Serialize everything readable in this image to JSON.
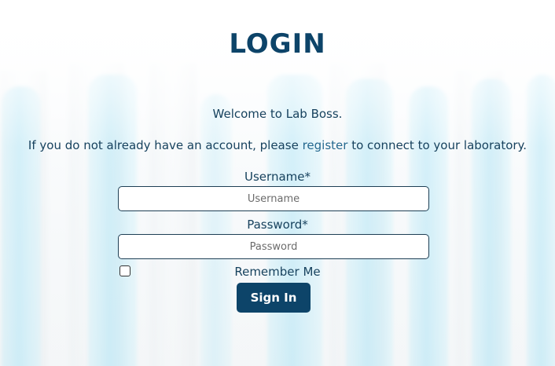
{
  "page": {
    "title": "LOGIN"
  },
  "intro": {
    "welcome": "Welcome to Lab Boss.",
    "info_before": "If you do not already have an account, please ",
    "register_link": "register",
    "info_after": " to connect to your laboratory."
  },
  "form": {
    "username_label": "Username*",
    "username_placeholder": "Username",
    "username_value": "",
    "password_label": "Password*",
    "password_placeholder": "Password",
    "password_value": "",
    "remember_label": "Remember Me",
    "remember_checked": false,
    "submit_label": "Sign In"
  },
  "colors": {
    "primary": "#0d4469",
    "text": "#17425e",
    "link": "#24688f",
    "background_accent": "#5ac8eb"
  },
  "background": {
    "image": "lab-glassware-background"
  }
}
